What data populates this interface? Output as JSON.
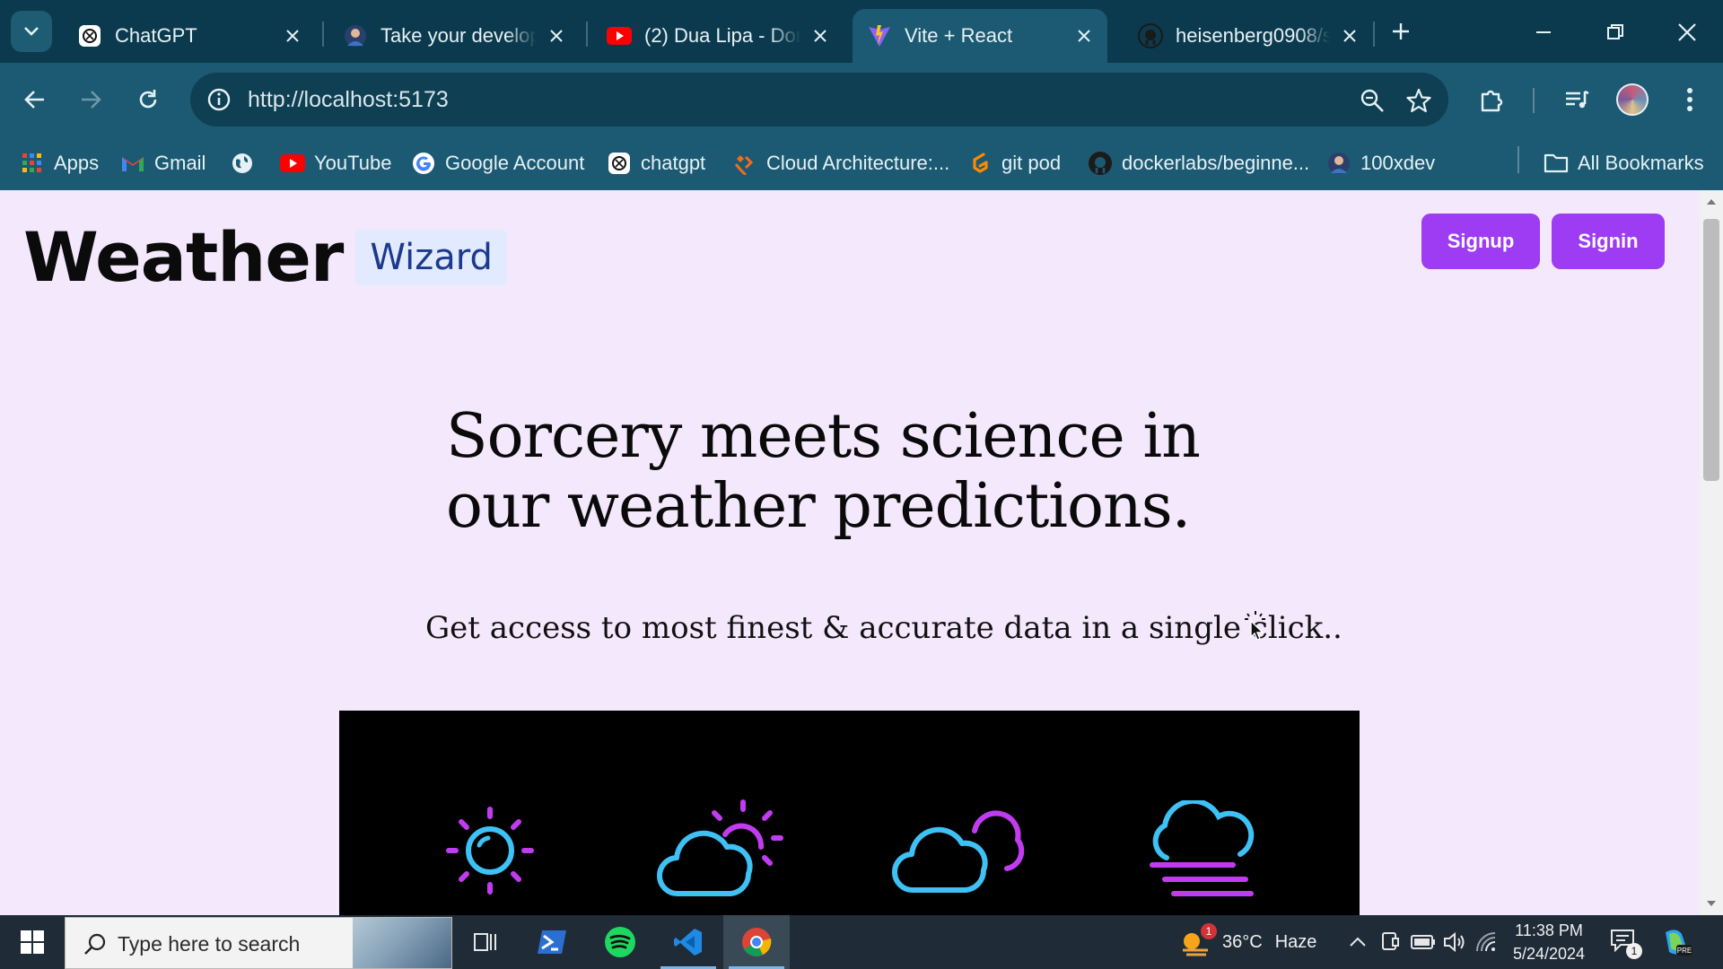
{
  "browser": {
    "tabs": [
      {
        "title": "ChatGPT",
        "favicon": "chatgpt-icon"
      },
      {
        "title": "Take your develop",
        "favicon": "avatar-icon"
      },
      {
        "title": "(2) Dua Lipa - Don",
        "favicon": "youtube-icon"
      },
      {
        "title": "Vite + React",
        "favicon": "vite-icon",
        "active": true
      },
      {
        "title": "heisenberg0908/s",
        "favicon": "github-icon"
      }
    ],
    "url": "http://localhost:5173",
    "bookmarks": [
      {
        "label": "Apps",
        "icon": "apps-grid-icon"
      },
      {
        "label": "Gmail",
        "icon": "gmail-icon"
      },
      {
        "label": "",
        "icon": "globe-icon"
      },
      {
        "label": "YouTube",
        "icon": "youtube-icon"
      },
      {
        "label": "Google Account",
        "icon": "google-icon"
      },
      {
        "label": "chatgpt",
        "icon": "chatgpt-icon"
      },
      {
        "label": "Cloud Architecture:...",
        "icon": "cloud-arch-icon"
      },
      {
        "label": "git pod",
        "icon": "gitpod-icon"
      },
      {
        "label": "dockerlabs/beginne...",
        "icon": "github-icon"
      },
      {
        "label": "100xdev",
        "icon": "avatar-icon"
      }
    ],
    "all_bookmarks": "All Bookmarks"
  },
  "page": {
    "brand_main": "Weather",
    "brand_badge": "Wizard",
    "signup": "Signup",
    "signin": "Signin",
    "hero_title": "Sorcery meets science in our weather predictions.",
    "hero_subtitle": "Get access to most finest & accurate data in a single click..",
    "weather_icons": [
      "sun-icon",
      "partly-cloudy-day-icon",
      "cloudy-icon",
      "fog-icon"
    ],
    "colors": {
      "accent": "#9d3cf2",
      "page_bg": "#f4e8fd",
      "icon_blue": "#3ec1f5",
      "icon_purple": "#c13cf0"
    }
  },
  "taskbar": {
    "search_placeholder": "Type here to search",
    "apps": [
      "task-view-icon",
      "powershell-icon",
      "spotify-icon",
      "vscode-icon",
      "chrome-icon"
    ],
    "weather_temp": "36°C",
    "weather_desc": "Haze",
    "weather_badge": "1",
    "time": "11:38 PM",
    "date": "5/24/2024",
    "notification_count": "1"
  }
}
